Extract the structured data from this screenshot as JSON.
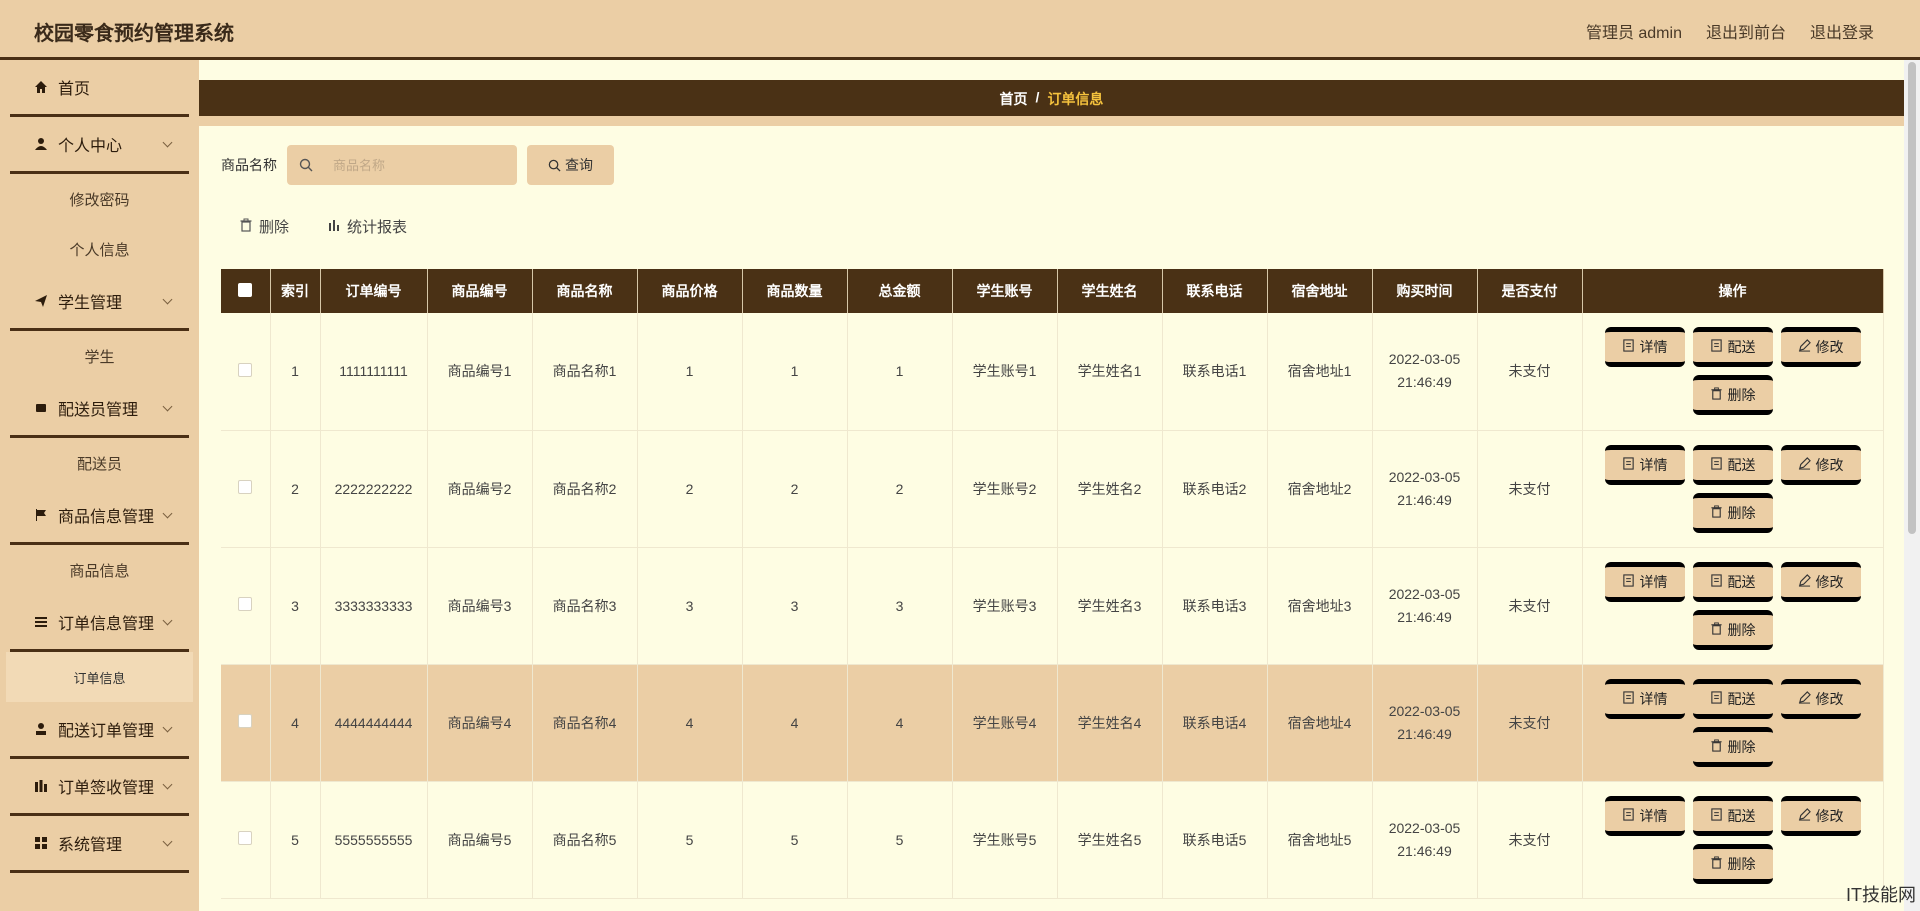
{
  "header": {
    "title": "校园零食预约管理系统",
    "admin": "管理员 admin",
    "front": "退出到前台",
    "logout": "退出登录"
  },
  "sidebar": {
    "home": "首页",
    "personal": "个人中心",
    "change_pwd": "修改密码",
    "personal_info": "个人信息",
    "student_mgmt": "学生管理",
    "student": "学生",
    "courier_mgmt": "配送员管理",
    "courier": "配送员",
    "goods_mgmt": "商品信息管理",
    "goods": "商品信息",
    "order_mgmt": "订单信息管理",
    "order": "订单信息",
    "delivery_mgmt": "配送订单管理",
    "signoff_mgmt": "订单签收管理",
    "system_mgmt": "系统管理"
  },
  "breadcrumb": {
    "home": "首页",
    "sep": "/",
    "current": "订单信息"
  },
  "search": {
    "label": "商品名称",
    "placeholder": "商品名称",
    "button": "查询"
  },
  "toolbar": {
    "delete": "删除",
    "report": "统计报表"
  },
  "table": {
    "headers": [
      "索引",
      "订单编号",
      "商品编号",
      "商品名称",
      "商品价格",
      "商品数量",
      "总金额",
      "学生账号",
      "学生姓名",
      "联系电话",
      "宿舍地址",
      "购买时间",
      "是否支付",
      "操作"
    ],
    "rows": [
      {
        "idx": "1",
        "order_no": "1111111111",
        "goods_no": "商品编号1",
        "goods_name": "商品名称1",
        "price": "1",
        "qty": "1",
        "total": "1",
        "account": "学生账号1",
        "name": "学生姓名1",
        "phone": "联系电话1",
        "addr": "宿舍地址1",
        "date": "2022-03-05",
        "time": "21:46:49",
        "paid": "未支付"
      },
      {
        "idx": "2",
        "order_no": "2222222222",
        "goods_no": "商品编号2",
        "goods_name": "商品名称2",
        "price": "2",
        "qty": "2",
        "total": "2",
        "account": "学生账号2",
        "name": "学生姓名2",
        "phone": "联系电话2",
        "addr": "宿舍地址2",
        "date": "2022-03-05",
        "time": "21:46:49",
        "paid": "未支付"
      },
      {
        "idx": "3",
        "order_no": "3333333333",
        "goods_no": "商品编号3",
        "goods_name": "商品名称3",
        "price": "3",
        "qty": "3",
        "total": "3",
        "account": "学生账号3",
        "name": "学生姓名3",
        "phone": "联系电话3",
        "addr": "宿舍地址3",
        "date": "2022-03-05",
        "time": "21:46:49",
        "paid": "未支付"
      },
      {
        "idx": "4",
        "order_no": "4444444444",
        "goods_no": "商品编号4",
        "goods_name": "商品名称4",
        "price": "4",
        "qty": "4",
        "total": "4",
        "account": "学生账号4",
        "name": "学生姓名4",
        "phone": "联系电话4",
        "addr": "宿舍地址4",
        "date": "2022-03-05",
        "time": "21:46:49",
        "paid": "未支付"
      },
      {
        "idx": "5",
        "order_no": "5555555555",
        "goods_no": "商品编号5",
        "goods_name": "商品名称5",
        "price": "5",
        "qty": "5",
        "total": "5",
        "account": "学生账号5",
        "name": "学生姓名5",
        "phone": "联系电话5",
        "addr": "宿舍地址5",
        "date": "2022-03-05",
        "time": "21:46:49",
        "paid": "未支付"
      }
    ],
    "actions": {
      "detail": "详情",
      "deliver": "配送",
      "edit": "修改",
      "delete": "删除"
    }
  },
  "watermark": "IT技能网",
  "colors": {
    "header_bg": "#ebcea5",
    "dark_brown": "#4a3115",
    "page_bg": "#fefde3",
    "breadcrumb_current": "#f5c23d"
  }
}
